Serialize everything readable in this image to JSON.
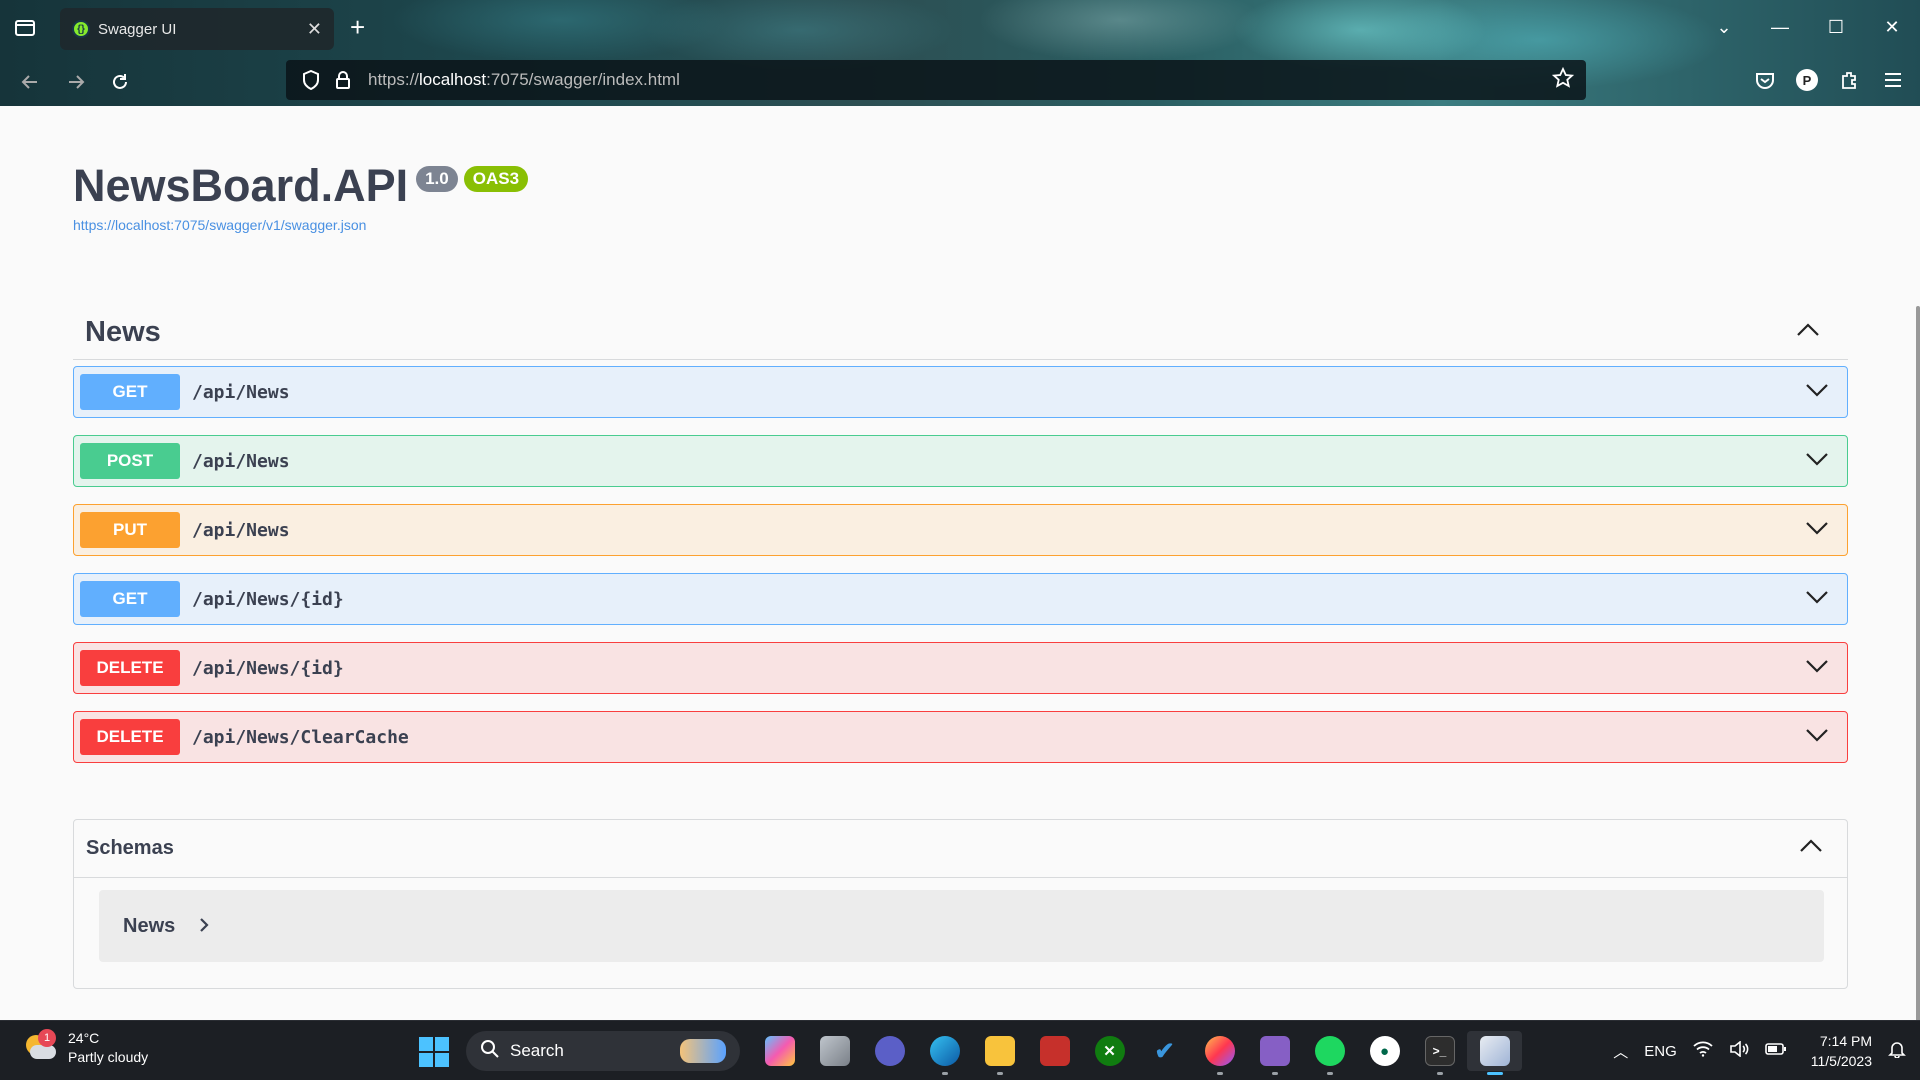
{
  "browser": {
    "tab_title": "Swagger UI",
    "tab_close": "✕",
    "new_tab": "+",
    "url_scheme": "https://",
    "url_host": "localhost",
    "url_rest": ":7075/swagger/index.html",
    "window_controls": [
      "—",
      "☐",
      "✕"
    ]
  },
  "page": {
    "title": "NewsBoard.API",
    "version_badge": "1.0",
    "oas_badge": "OAS3",
    "spec_link": "https://localhost:7075/swagger/v1/swagger.json"
  },
  "tag": {
    "name": "News"
  },
  "operations": [
    {
      "method": "GET",
      "path": "/api/News",
      "color": "#61affe"
    },
    {
      "method": "POST",
      "path": "/api/News",
      "color": "#49cc90"
    },
    {
      "method": "PUT",
      "path": "/api/News",
      "color": "#fca130"
    },
    {
      "method": "GET",
      "path": "/api/News/{id}",
      "color": "#61affe"
    },
    {
      "method": "DELETE",
      "path": "/api/News/{id}",
      "color": "#f93e3e"
    },
    {
      "method": "DELETE",
      "path": "/api/News/ClearCache",
      "color": "#f93e3e"
    }
  ],
  "schemas": {
    "title": "Schemas",
    "models": [
      "News"
    ]
  },
  "taskbar": {
    "weather_temp": "24°C",
    "weather_desc": "Partly cloudy",
    "weather_badge": "1",
    "search_label": "Search",
    "language": "ENG",
    "time": "7:14 PM",
    "date": "11/5/2023"
  }
}
